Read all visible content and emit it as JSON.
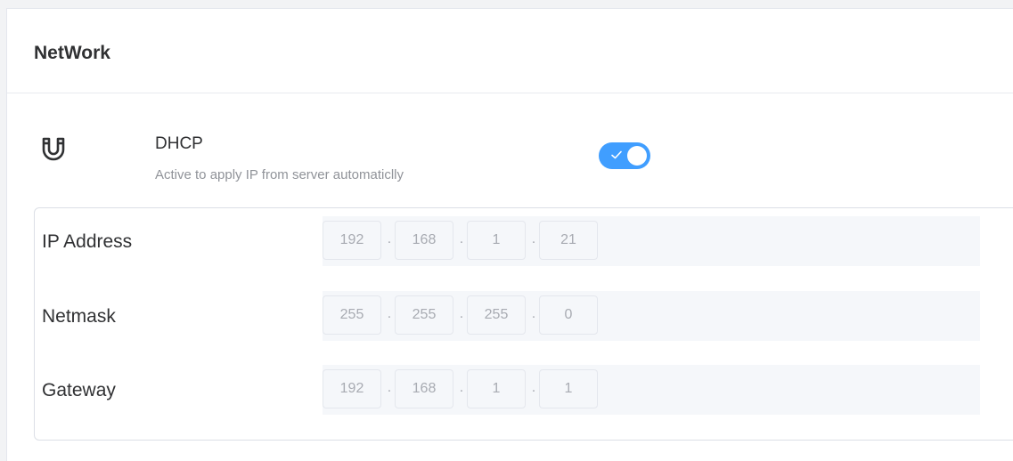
{
  "card": {
    "title": "NetWork"
  },
  "dhcp": {
    "icon": "magnet-icon",
    "title": "DHCP",
    "description": "Active to apply IP from server automaticlly",
    "enabled": true,
    "accent_color": "#409eff"
  },
  "fields": [
    {
      "label": "IP Address",
      "octets": [
        "192",
        "168",
        "1",
        "21"
      ],
      "separator": "."
    },
    {
      "label": "Netmask",
      "octets": [
        "255",
        "255",
        "255",
        "0"
      ],
      "separator": "."
    },
    {
      "label": "Gateway",
      "octets": [
        "192",
        "168",
        "1",
        "1"
      ],
      "separator": "."
    }
  ]
}
